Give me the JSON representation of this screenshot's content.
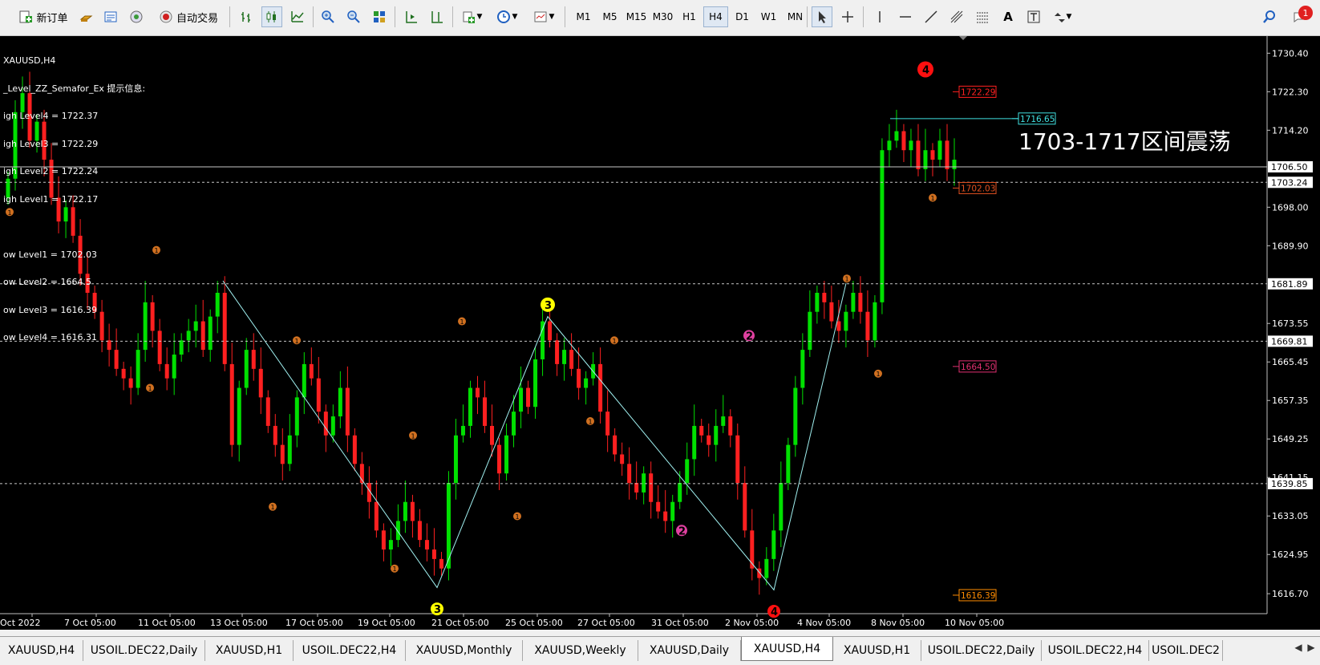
{
  "toolbar": {
    "new_order_label": "新订单",
    "autotrade_label": "自动交易",
    "timeframes": [
      "M1",
      "M5",
      "M15",
      "M30",
      "H1",
      "H4",
      "D1",
      "W1",
      "MN"
    ],
    "active_timeframe": "H4",
    "notification_count": "1"
  },
  "info": {
    "header": "XAUUSD,H4",
    "indicator": "_Level_ZZ_Semafor_Ex 提示信息:",
    "lines": [
      "igh Level4 = 1722.37",
      "igh Level3 = 1722.29",
      "igh Level2 = 1722.24",
      "igh Level1 = 1722.17",
      "",
      "ow Level1 = 1702.03",
      "ow Level2 = 1664.5",
      "ow Level3 = 1616.39",
      "ow Level4 = 1616.31"
    ]
  },
  "annotation": "1703-1717区间震荡",
  "chart_data": {
    "type": "candlestick",
    "symbol": "XAUUSD",
    "timeframe": "H4",
    "ylim": [
      1612.5,
      1734.0
    ],
    "y_ticks": [
      "1730.40",
      "1722.30",
      "1714.20",
      "1706.50",
      "1698.00",
      "1689.90",
      "1681.89",
      "1673.55",
      "1665.45",
      "1657.35",
      "1649.25",
      "1641.15",
      "1633.05",
      "1624.95",
      "1616.70"
    ],
    "x_ticks": [
      "Oct 2022",
      "7 Oct 05:00",
      "11 Oct 05:00",
      "13 Oct 05:00",
      "17 Oct 05:00",
      "19 Oct 05:00",
      "21 Oct 05:00",
      "25 Oct 05:00",
      "27 Oct 05:00",
      "31 Oct 05:00",
      "2 Nov 05:00",
      "4 Nov 05:00",
      "8 Nov 05:00",
      "10 Nov 05:00"
    ],
    "current_price": 1706.5,
    "horizontal_lines": [
      {
        "value": 1703.24,
        "label": "1703.24"
      },
      {
        "value": 1681.89,
        "label": "1681.89"
      },
      {
        "value": 1669.81,
        "label": "1669.81"
      },
      {
        "value": 1639.85,
        "label": "1639.85"
      }
    ],
    "level_labels": [
      {
        "value": 1722.29,
        "label": "1722.29",
        "color": "#ff2020"
      },
      {
        "value": 1716.65,
        "label": "1716.65",
        "color": "#40e0e0"
      },
      {
        "value": 1702.03,
        "label": "1702.03",
        "color": "#e05020"
      },
      {
        "value": 1664.5,
        "label": "1664.50",
        "color": "#e03070"
      },
      {
        "value": 1616.39,
        "label": "1616.39",
        "color": "#ff8c00"
      }
    ],
    "zigzag": [
      [
        1682.5,
        "13 Oct"
      ],
      [
        1618.0,
        "21 Oct"
      ],
      [
        1675.0,
        "25 Oct"
      ],
      [
        1617.5,
        "3 Nov"
      ],
      [
        1682.0,
        "4 Nov"
      ]
    ],
    "semafor_markers": [
      {
        "label": "4",
        "color": "#ff1010",
        "value": 1727.0
      },
      {
        "label": "3",
        "color": "#ffff00",
        "value": 1677.0
      },
      {
        "label": "2",
        "color": "#e040a0",
        "value": 1671.0
      },
      {
        "label": "2",
        "color": "#e040a0",
        "value": 1630.0
      }
    ],
    "colors": {
      "bull": "#00e000",
      "bear": "#ff2020",
      "zigzag": "#a0f0f0"
    }
  },
  "tabs": [
    {
      "label": "XAUUSD,H4"
    },
    {
      "label": "USOIL.DEC22,Daily"
    },
    {
      "label": "XAUUSD,H1"
    },
    {
      "label": "USOIL.DEC22,H4"
    },
    {
      "label": "XAUUSD,Monthly"
    },
    {
      "label": "XAUUSD,Weekly"
    },
    {
      "label": "XAUUSD,Daily"
    },
    {
      "label": "XAUUSD,H4"
    },
    {
      "label": "XAUUSD,H1"
    },
    {
      "label": "USOIL.DEC22,Daily"
    },
    {
      "label": "USOIL.DEC22,H4"
    },
    {
      "label": "USOIL.DEC2"
    }
  ],
  "active_tab": 7
}
